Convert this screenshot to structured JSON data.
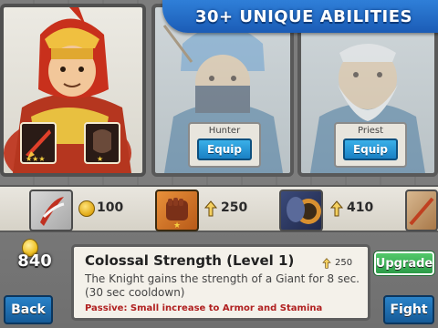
{
  "banner": {
    "text": "30+ UNIQUE ABILITIES"
  },
  "heroes": [
    {
      "name": "Knight",
      "selected": true
    },
    {
      "name": "Hunter",
      "equip_label": "Equip",
      "selected": false
    },
    {
      "name": "Priest",
      "equip_label": "Equip",
      "selected": false
    }
  ],
  "abilities": [
    {
      "icon": "wing-slash-icon",
      "currency_icon": "gold-coin-icon",
      "cost": "100"
    },
    {
      "icon": "giant-fist-icon",
      "currency_icon": "upgrade-arrow-icon",
      "cost": "250",
      "selected": true
    },
    {
      "icon": "shield-helm-icon",
      "currency_icon": "upgrade-arrow-icon",
      "cost": "410"
    },
    {
      "icon": "flame-blade-icon"
    }
  ],
  "gold": {
    "amount": "840"
  },
  "detail": {
    "title": "Colossal Strength (Level 1)",
    "cost": "250",
    "description": "The Knight gains the strength of a Giant for 8 sec. (30 sec cooldown)",
    "passive": "Passive: Small increase to Armor and Stamina"
  },
  "buttons": {
    "upgrade": "Upgrade",
    "back": "Back",
    "fight": "Fight"
  },
  "colors": {
    "accent_blue": "#1b5cb6",
    "upgrade_green": "#2c9c48",
    "passive_red": "#b02020"
  }
}
